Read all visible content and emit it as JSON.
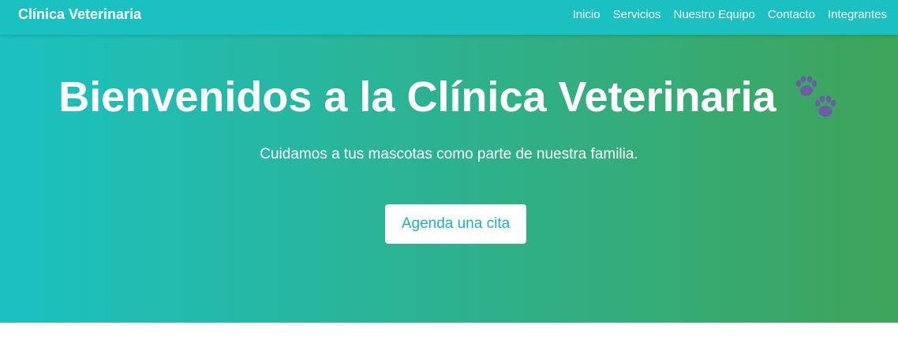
{
  "nav": {
    "brand": "Clínica Veterinaria",
    "links": [
      "Inicio",
      "Servicios",
      "Nuestro Equipo",
      "Contacto",
      "Integrantes"
    ]
  },
  "hero": {
    "title": "Bienvenidos a la Clínica Veterinaria",
    "subtitle": "Cuidamos a tus mascotas como parte de nuestra familia.",
    "cta_label": "Agenda una cita",
    "icon": "paw-prints-icon"
  },
  "colors": {
    "navbar": "#1bc1c1",
    "gradient_start": "#1bc1c1",
    "gradient_end": "#3ea45a",
    "paw": "#6f5aa6",
    "cta_text": "#1bb3b5"
  }
}
